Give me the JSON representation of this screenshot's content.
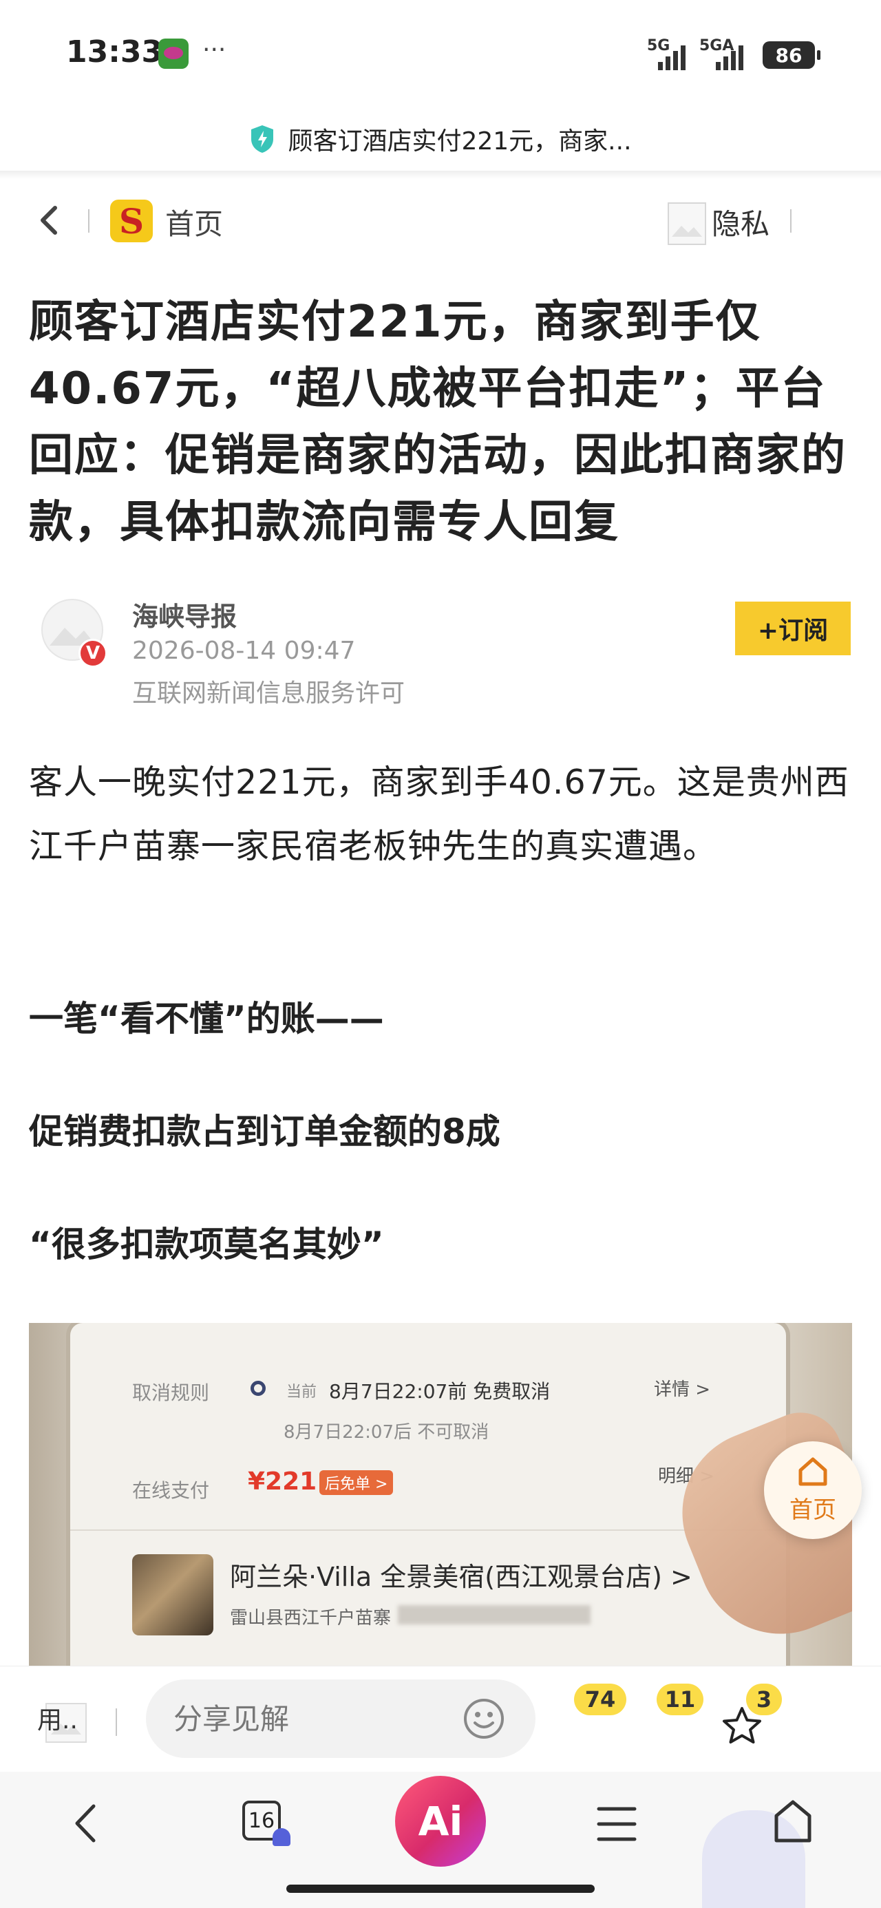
{
  "status_bar": {
    "time": "13:33",
    "more": "···",
    "signal_1": "5G",
    "signal_2": "5GA",
    "battery": "86"
  },
  "notification": {
    "text": "顾客订酒店实付221元，商家..."
  },
  "nav": {
    "home_label": "首页",
    "logo_letter": "S",
    "privacy_label": "隐私"
  },
  "article": {
    "title": "顾客订酒店实付221元，商家到手仅40.67元，“超八成被平台扣走”；平台回应：促销是商家的活动，因此扣商家的款，具体扣款流向需专人回复",
    "author": {
      "name": "海峡导报",
      "date": "2026-08-14 09:47",
      "license": "互联网新闻信息服务许可",
      "verified_mark": "V",
      "subscribe_label": "+订阅"
    },
    "paragraph_1": "客人一晚实付221元，商家到手40.67元。这是贵州西江千户苗寨一家民宿老板钟先生的真实遭遇。",
    "subheads": [
      "一笔“看不懂”的账——",
      "促销费扣款占到订单金额的8成",
      "“很多扣款项莫名其妙”"
    ]
  },
  "photo": {
    "row1_label": "取消规则",
    "row1_prefix": "当前",
    "row1_value": "8月7日22:07前 免费取消",
    "row1_link": "详情 >",
    "row1_sub": "8月7日22:07后 不可取消",
    "row2_label": "在线支付",
    "row2_amount": "¥221",
    "row2_tag": "后免单 >",
    "row2_link": "明细 >",
    "hotel_name": "阿兰朵·Villa 全景美宿(西江观景台店) >",
    "hotel_address": "雷山县西江千户苗寨"
  },
  "floating_home": {
    "label": "首页"
  },
  "comment_bar": {
    "user_label": "用..",
    "placeholder": "分享见解",
    "comments_count": "74",
    "likes_count": "11",
    "favorites_count": "3"
  },
  "bottom_nav": {
    "tabs_count": "16",
    "ai_label": "Ai"
  },
  "colors": {
    "accent_yellow": "#F7CA2D",
    "verified_red": "#E23A3A",
    "floating_orange": "#E07A1A",
    "price_red": "#E23A2A"
  }
}
